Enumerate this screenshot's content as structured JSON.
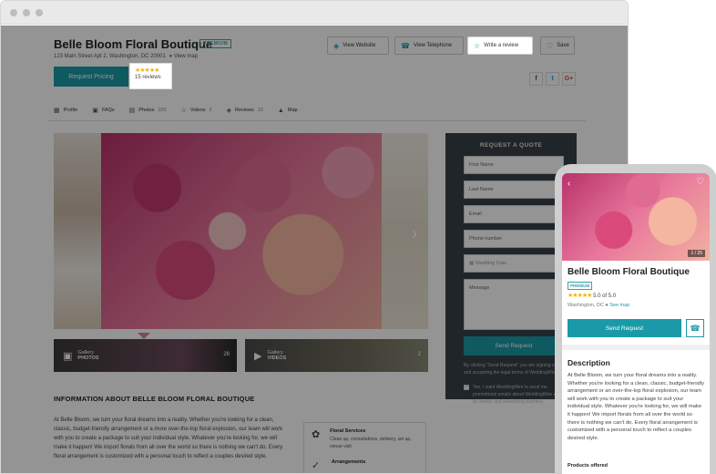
{
  "business": {
    "name": "Belle Bloom Floral Boutique",
    "badge": "PREMIUM",
    "address": "123 Main Street Apt 2, Washington, DC 20001",
    "view_map": "View map"
  },
  "header": {
    "pricing_label": "Request Pricing",
    "rating_stars": "★★★★★",
    "reviews_count": "15 reviews",
    "actions": {
      "website": "View Website",
      "telephone": "View Telephone",
      "review": "Write a review",
      "save": "Save"
    },
    "social": [
      "f",
      "t",
      "G+"
    ]
  },
  "nav": {
    "profile": "Profile",
    "faqs": "FAQs",
    "photos": "Photos",
    "photos_count": "100",
    "videos": "Videos",
    "videos_count": "2",
    "reviews": "Reviews",
    "reviews_count": "15",
    "map": "Map"
  },
  "gallery": {
    "photos_label": "Gallery",
    "photos_sub": "PHOTOS",
    "photos_count": "28",
    "videos_label": "Gallery",
    "videos_sub": "VIDEOS",
    "videos_count": "2"
  },
  "info": {
    "title": "INFORMATION ABOUT BELLE BLOOM FLORAL BOUTIQUE",
    "text": "At Belle Bloom, we turn your floral dreams into a reality. Whether you're looking for a clean, classic, budget-friendly arrangement or a more over-the-top floral explosion, our team will work with you to create a package to suit your individual style. Whatever you're looking for, we will make it happen! We import florals from all over the world so there is nothing we can't do. Every floral arrangement is customized with a personal touch to reflect a couples desired style."
  },
  "services": {
    "s1_title": "Floral Services",
    "s1_desc": "Clean up, consultations, delivery, set up, venue visit",
    "s2_title": "Arrangements"
  },
  "quote": {
    "title": "REQUEST A QUOTE",
    "first_name": "First Name",
    "last_name": "Last Name",
    "email": "Email",
    "phone": "Phone number",
    "wedding_date": "Wedding Date",
    "message": "Message",
    "send": "Send Request",
    "terms": "By clicking \"Send Request\" you are signing up and accepting the legal terms of WeddingWire.",
    "checkbox_text": "Yes, I want WeddingWire to send me promotional emails about WeddingWire and its vendor and advertising partners."
  },
  "phone": {
    "photo_count": "1 / 25",
    "name": "Belle Bloom Floral Boutique",
    "badge": "PREMIUM",
    "rating_stars": "★★★★★",
    "rating_text": "5.0 of 5.0",
    "location": "Washington, DC",
    "see_map": "See map",
    "send": "Send Request",
    "desc_title": "Description",
    "desc_text": "At Belle Bloom, we turn your floral dreams into a reality. Whether you're looking for a clean, classic, budget-friendly arrangement or an over-the-top floral explosion, our team will work with you to create a package to suit your individual style. Whatever you're looking for, we will make it happen! We import florals from all over the world so there is nothing we can't do. Every floral arrangement is customized with a personal touch to reflect a couples desired style.",
    "products_title": "Products offered"
  },
  "colors": {
    "accent": "#1a9aa8",
    "star": "#f5b400",
    "quote_bg": "#374047"
  }
}
